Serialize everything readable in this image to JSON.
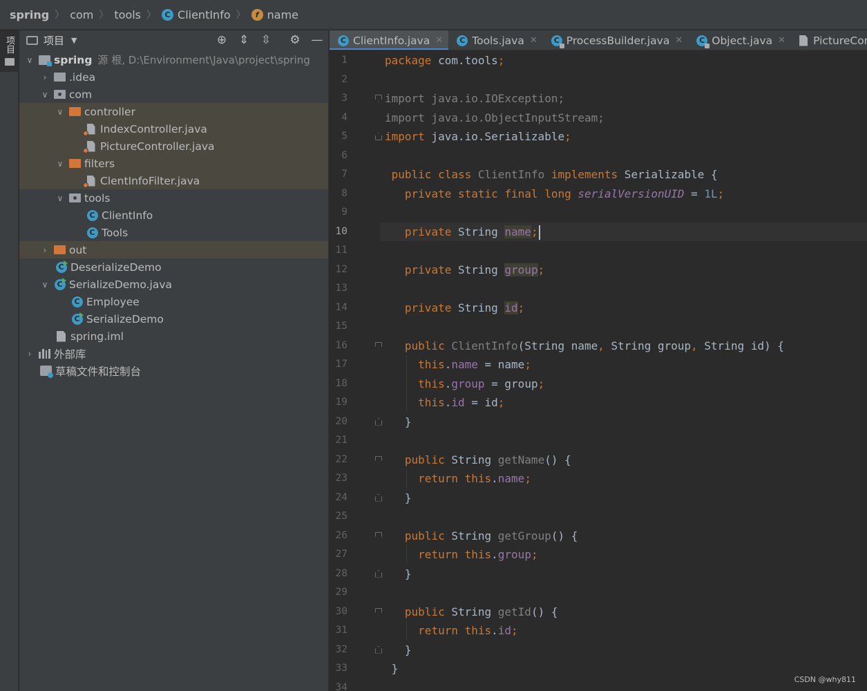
{
  "breadcrumb": {
    "items": [
      "spring",
      "com",
      "tools",
      "ClientInfo",
      "name"
    ],
    "class_icon_letter": "C",
    "field_icon_letter": "f"
  },
  "left_strip": {
    "label": "项目"
  },
  "project_panel": {
    "title": "项目",
    "tree": [
      {
        "label": "spring",
        "sub": "源 根, D:\\Environment\\Java\\project\\spring"
      },
      {
        "label": ".idea"
      },
      {
        "label": "com"
      },
      {
        "label": "controller"
      },
      {
        "label": "IndexController.java"
      },
      {
        "label": "PictureController.java"
      },
      {
        "label": "filters"
      },
      {
        "label": "ClentInfoFilter.java"
      },
      {
        "label": "tools"
      },
      {
        "label": "ClientInfo"
      },
      {
        "label": "Tools"
      },
      {
        "label": "out"
      },
      {
        "label": "DeserializeDemo"
      },
      {
        "label": "SerializeDemo.java"
      },
      {
        "label": "Employee"
      },
      {
        "label": "SerializeDemo"
      },
      {
        "label": "spring.iml"
      },
      {
        "label": "外部库"
      },
      {
        "label": "草稿文件和控制台"
      }
    ]
  },
  "tabs": [
    "ClientInfo.java",
    "Tools.java",
    "ProcessBuilder.java",
    "Object.java",
    "PictureContro"
  ],
  "editor": {
    "current_line": 10,
    "lines": [
      "1",
      "2",
      "3",
      "4",
      "5",
      "6",
      "7",
      "8",
      "9",
      "10",
      "11",
      "12",
      "13",
      "14",
      "15",
      "16",
      "17",
      "18",
      "19",
      "20",
      "21",
      "22",
      "23",
      "24",
      "25",
      "26",
      "27",
      "28",
      "29",
      "30",
      "31",
      "32",
      "33",
      "34"
    ]
  },
  "watermark": "CSDN @why811",
  "colors": {
    "keyword": "#cc7832",
    "field": "#9876aa",
    "number": "#6897bb",
    "text": "#a9b7c6",
    "comment_gray": "#808080",
    "accent": "#4a88c7"
  }
}
